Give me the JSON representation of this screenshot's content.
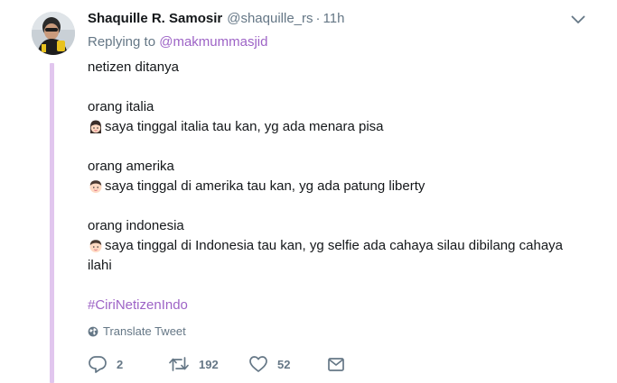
{
  "tweet": {
    "author_name": "Shaquille R. Samosir",
    "author_handle": "@shaquille_rs",
    "separator": "·",
    "time": "11h",
    "replying_prefix": "Replying to",
    "replying_to": "@makmummasjid",
    "lines": {
      "l1": "netizen ditanya",
      "l2": "orang italia",
      "l3": "saya tinggal italia tau kan, yg ada menara pisa",
      "l4": "orang amerika",
      "l5": "saya tinggal di amerika tau kan, yg ada patung liberty",
      "l6": "orang indonesia",
      "l7": "saya tinggal di Indonesia tau kan, yg selfie ada cahaya silau dibilang cahaya",
      "l8": "ilahi"
    },
    "hashtag": "#CiriNetizenIndo",
    "translate_label": "Translate Tweet"
  },
  "actions": {
    "reply_count": "2",
    "retweet_count": "192",
    "like_count": "52"
  },
  "icons": {
    "caret": "chevron-down-icon",
    "globe": "globe-icon",
    "reply": "reply-icon",
    "retweet": "retweet-icon",
    "like": "heart-icon",
    "dm": "envelope-icon",
    "emoji_girl": "girl-emoji",
    "emoji_boy": "boy-emoji"
  },
  "colors": {
    "accent": "#9d63c6",
    "thread_line": "#e1c6ee",
    "secondary_text": "#657786",
    "primary_text": "#14171a"
  }
}
